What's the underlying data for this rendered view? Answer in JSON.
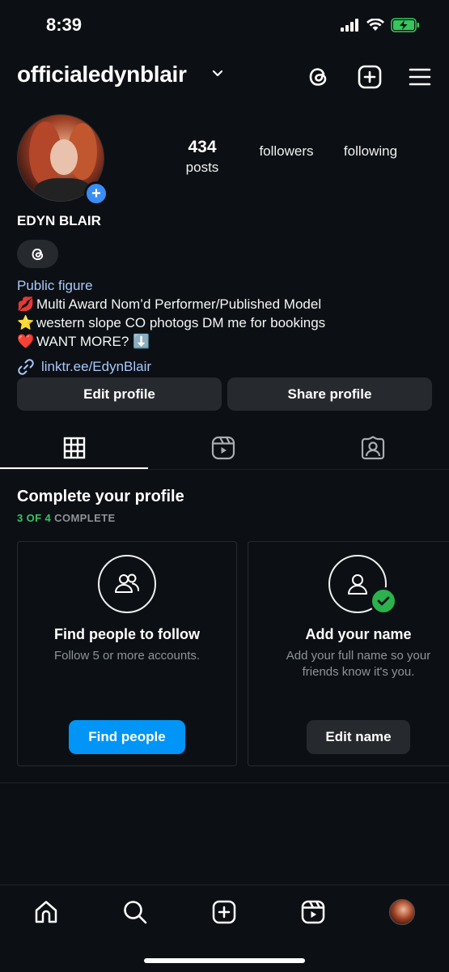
{
  "status_bar": {
    "time": "8:39"
  },
  "header": {
    "username": "officialedynblair"
  },
  "stats": [
    {
      "number": "434",
      "label": "posts"
    },
    {
      "number": "",
      "label": "followers"
    },
    {
      "number": "",
      "label": "following"
    }
  ],
  "profile": {
    "display_name": "EDYN BLAIR",
    "category": "Public figure",
    "bio": [
      {
        "emoji": "💋",
        "text": "Multi Award Nom’d Performer/Published Model"
      },
      {
        "emoji": "⭐",
        "text": "western slope CO photogs DM me for bookings"
      },
      {
        "emoji": "❤️",
        "text": "WANT MORE? ⬇️"
      }
    ],
    "link": "linktr.ee/EdynBlair"
  },
  "buttons": {
    "edit_profile": "Edit profile",
    "share_profile": "Share profile"
  },
  "complete_profile": {
    "title": "Complete your profile",
    "progress_done": "3 OF 4",
    "progress_rest": " COMPLETE",
    "cards": [
      {
        "title": "Find people to follow",
        "subtitle": "Follow 5 or more accounts.",
        "button": "Find people"
      },
      {
        "title": "Add your name",
        "subtitle": "Add your full name so your friends know it's you.",
        "button": "Edit name"
      }
    ]
  },
  "colors": {
    "background": "#0c1014",
    "accent_blue": "#0095f6",
    "link": "#a8c7fa",
    "success": "#37c464"
  }
}
